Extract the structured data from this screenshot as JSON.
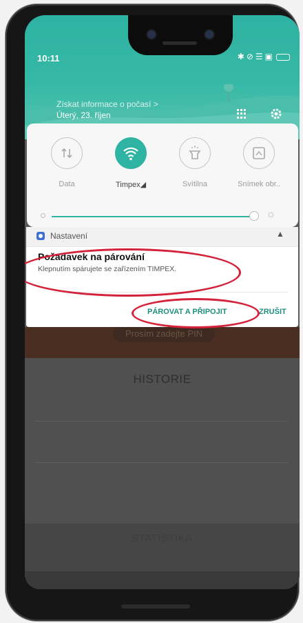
{
  "status_bar": {
    "time": "10:11",
    "icons": [
      "bluetooth-icon",
      "alarm-icon",
      "wifi-icon",
      "screen-icon",
      "battery-icon"
    ]
  },
  "header": {
    "weather_link": "Získat informace o počasí >",
    "date": "Úterý, 23. říjen"
  },
  "quick_settings": {
    "tiles": [
      {
        "label": "Data",
        "icon": "mobile-data-icon",
        "active": false
      },
      {
        "label": "Timpex◢",
        "icon": "wifi-icon",
        "active": true
      },
      {
        "label": "Svítilna",
        "icon": "flashlight-icon",
        "active": false
      },
      {
        "label": "Snímek obr..",
        "icon": "screenshot-icon",
        "active": false
      }
    ],
    "brightness": 0.95
  },
  "notification": {
    "app_name": "Nastavení",
    "title": "Požadavek na párování",
    "text": "Klepnutím spárujete se zařízením TIMPEX.",
    "action_pair": "PÁROVAT A PŘIPOJIT",
    "action_cancel": "ZRUŠIT"
  },
  "background_app": {
    "pin_button": "Prosím zadejte PIN",
    "history_title": "HISTORIE",
    "stats_title": "STATISTIKA"
  },
  "colors": {
    "accent": "#2fb3a3",
    "highlight_ring": "#d4223a"
  }
}
